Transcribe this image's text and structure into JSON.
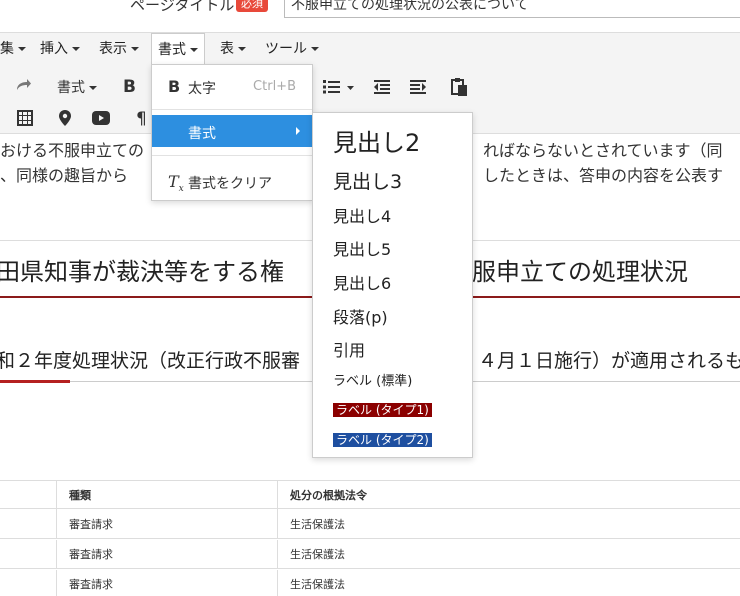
{
  "title_bar": {
    "label": "ページタイトル",
    "required_badge": "必須",
    "title_value": "不服申立ての処理状況の公表について"
  },
  "menubar": {
    "items": [
      "集",
      "挿入",
      "表示",
      "書式",
      "表",
      "ツール"
    ]
  },
  "toolbar": {
    "format_select": "書式",
    "bold": "B",
    "pilcrow": "¶"
  },
  "dropdown": {
    "bold_label": "太字",
    "bold_shortcut": "Ctrl+B",
    "format_label": "書式",
    "clear_label": "書式をクリア"
  },
  "submenu": {
    "items": [
      "見出し2",
      "見出し3",
      "見出し4",
      "見出し5",
      "見出し6",
      "段落(p)",
      "引用",
      "ラベル (標準)",
      "ラベル (タイプ1)",
      "ラベル (タイプ2)"
    ]
  },
  "content": {
    "para1_left": "おける不服申立ての",
    "para1_right": "ればならないとされています（同",
    "para2_left": "、同様の趣旨から",
    "para2_right": "したときは、答申の内容を公表す",
    "h2_left": "田県知事が裁決等をする権",
    "h2_right": "服申立ての処理状況",
    "h3_left": "和２年度処理状況（改正行政不服審",
    "h3_right": "４月１日施行）が適用されるも"
  },
  "table": {
    "headers": [
      "",
      "種類",
      "処分の根拠法令"
    ],
    "rows": [
      [
        "",
        "審査請求",
        "生活保護法"
      ],
      [
        "",
        "審査請求",
        "生活保護法"
      ],
      [
        "",
        "審査請求",
        "生活保護法"
      ]
    ]
  }
}
